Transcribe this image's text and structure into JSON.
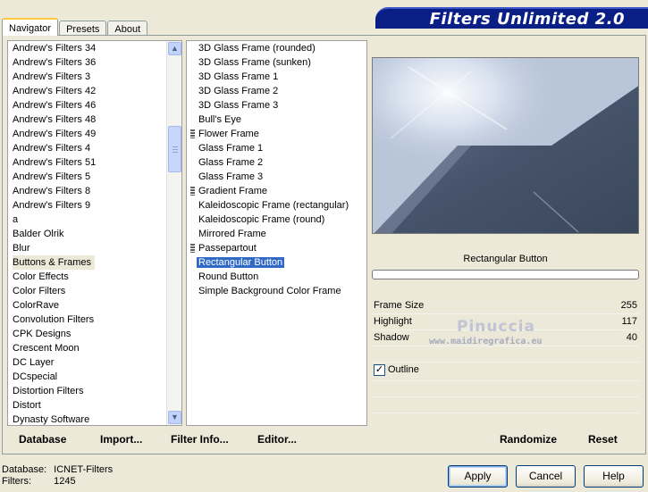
{
  "header": {
    "title": "Filters Unlimited 2.0"
  },
  "tabs": [
    {
      "label": "Navigator",
      "active": true
    },
    {
      "label": "Presets",
      "active": false
    },
    {
      "label": "About",
      "active": false
    }
  ],
  "categories": {
    "items": [
      "Andrew's Filters 34",
      "Andrew's Filters 36",
      "Andrew's Filters 3",
      "Andrew's Filters 42",
      "Andrew's Filters 46",
      "Andrew's Filters 48",
      "Andrew's Filters 49",
      "Andrew's Filters 4",
      "Andrew's Filters 51",
      "Andrew's Filters 5",
      "Andrew's Filters 8",
      "Andrew's Filters 9",
      "a",
      "Balder Olrik",
      "Blur",
      "Buttons & Frames",
      "Color Effects",
      "Color Filters",
      "ColorRave",
      "Convolution Filters",
      "CPK Designs",
      "Crescent Moon",
      "DC Layer",
      "DCspecial",
      "Distortion Filters",
      "Distort",
      "Dynasty Software"
    ],
    "selected_index": 15
  },
  "filters": {
    "items": [
      {
        "label": "3D Glass Frame (rounded)",
        "group": false
      },
      {
        "label": "3D Glass Frame (sunken)",
        "group": false
      },
      {
        "label": "3D Glass Frame 1",
        "group": false
      },
      {
        "label": "3D Glass Frame 2",
        "group": false
      },
      {
        "label": "3D Glass Frame 3",
        "group": false
      },
      {
        "label": "Bull's Eye",
        "group": false
      },
      {
        "label": "Flower Frame",
        "group": true
      },
      {
        "label": "Glass Frame 1",
        "group": false
      },
      {
        "label": "Glass Frame 2",
        "group": false
      },
      {
        "label": "Glass Frame 3",
        "group": false
      },
      {
        "label": "Gradient Frame",
        "group": true
      },
      {
        "label": "Kaleidoscopic Frame (rectangular)",
        "group": false
      },
      {
        "label": "Kaleidoscopic Frame (round)",
        "group": false
      },
      {
        "label": "Mirrored Frame",
        "group": false
      },
      {
        "label": "Passepartout",
        "group": true
      },
      {
        "label": "Rectangular Button",
        "group": false
      },
      {
        "label": "Round Button",
        "group": false
      },
      {
        "label": "Simple Background Color Frame",
        "group": false
      }
    ],
    "selected_index": 15
  },
  "preview": {
    "filter_name": "Rectangular Button"
  },
  "params": [
    {
      "label": "Frame Size",
      "value": "255"
    },
    {
      "label": "Highlight",
      "value": "117"
    },
    {
      "label": "Shadow",
      "value": "40"
    }
  ],
  "outline": {
    "label": "Outline",
    "checked": true,
    "mark": "✓"
  },
  "watermark": {
    "line1": "Pinuccia",
    "line2": "www.maidiregrafica.eu"
  },
  "left_bar": {
    "database": "Database",
    "import": "Import...",
    "filter_info": "Filter Info...",
    "editor": "Editor..."
  },
  "right_bar": {
    "randomize": "Randomize",
    "reset": "Reset"
  },
  "status": {
    "database_label": "Database:",
    "database_value": "ICNET-Filters",
    "filters_label": "Filters:",
    "filters_value": "1245"
  },
  "buttons": {
    "apply": "Apply",
    "cancel": "Cancel",
    "help": "Help"
  },
  "icons": {
    "scroll_up": "scroll-up-icon",
    "scroll_down": "scroll-down-icon",
    "group": "group-bars-icon"
  },
  "colors": {
    "banner": "#0a1f86",
    "selection": "#316ac5",
    "window": "#ece9d8"
  }
}
